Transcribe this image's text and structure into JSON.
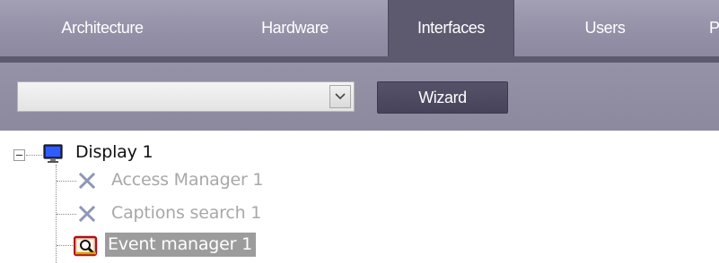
{
  "tabs": [
    {
      "label": "Architecture",
      "active": false
    },
    {
      "label": "Hardware",
      "active": false
    },
    {
      "label": "Interfaces",
      "active": true
    },
    {
      "label": "Users",
      "active": false
    },
    {
      "label": "P",
      "active": false
    }
  ],
  "toolbar": {
    "dropdown_value": "",
    "wizard_label": "Wizard"
  },
  "tree": {
    "root": {
      "label": "Display 1",
      "icon": "display-icon",
      "expanded": true
    },
    "children": [
      {
        "label": "Access Manager 1",
        "icon": "disabled-x-icon",
        "state": "disabled"
      },
      {
        "label": "Captions search 1",
        "icon": "disabled-x-icon",
        "state": "disabled"
      },
      {
        "label": "Event manager 1",
        "icon": "event-manager-icon",
        "state": "selected"
      }
    ]
  },
  "colors": {
    "tabbar": "#928fa6",
    "active_tab": "#5d5a70",
    "wizard_button": "#4b485f",
    "selection": "#9c9c9c",
    "disabled_text": "#a8a8a8"
  }
}
